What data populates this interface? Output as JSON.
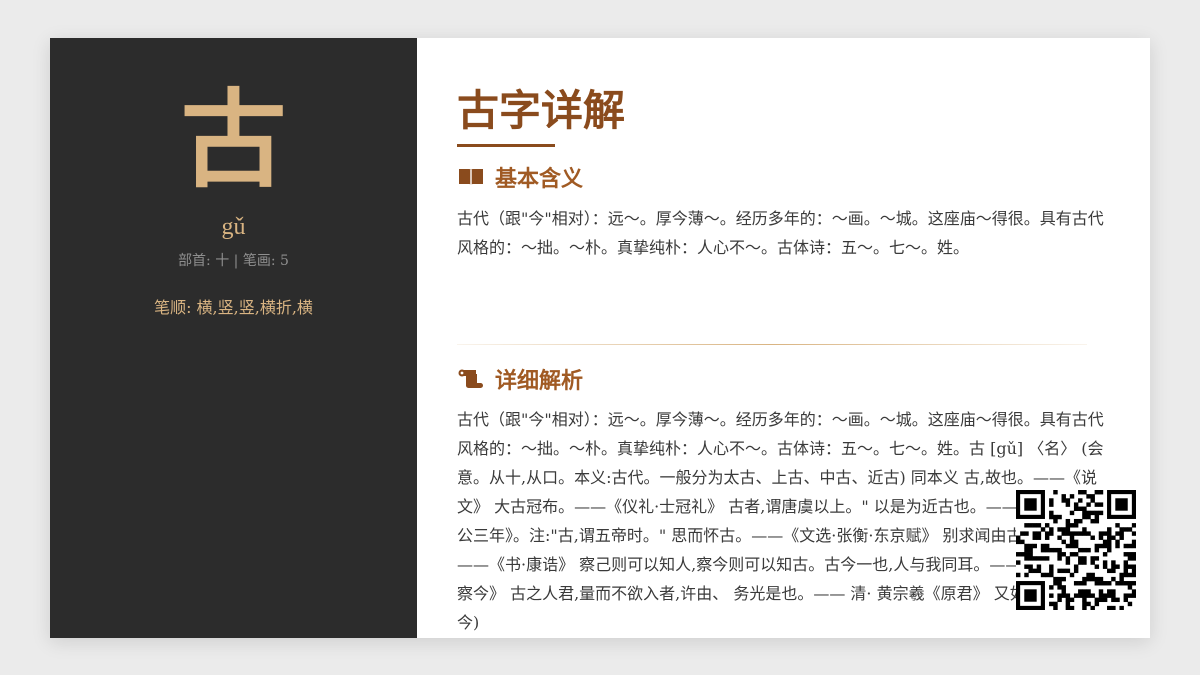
{
  "character": {
    "glyph": "古",
    "pinyin": "gǔ",
    "radical_strokes": "部首: 十 | 笔画: 5",
    "stroke_order": "笔顺: 横,竖,竖,横折,横"
  },
  "main": {
    "title": "古字详解",
    "basic": {
      "heading": "基本含义",
      "icon": "book-icon",
      "text": "古代（跟\"今\"相对）：远～。厚今薄～。经历多年的：～画。～城。这座庙～得很。具有古代风格的：～拙。～朴。真挚纯朴：人心不～。古体诗：五～。七～。姓。"
    },
    "detail": {
      "heading": "详细解析",
      "icon": "scroll-icon",
      "text": "古代（跟\"今\"相对）：远～。厚今薄～。经历多年的：～画。～城。这座庙～得很。具有古代风格的：～拙。～朴。真挚纯朴：人心不～。古体诗：五～。七～。姓。古 [gǔ] 〈名〉 (会意。从十,从口。本义:古代。一般分为太古、上古、中古、近古) 同本义 古,故也。——《说文》 大古冠布。——《仪礼·士冠礼》 古者,谓唐虞以上。\" 以是为近古也。——《谷梁传·桓公三年》。注:\"古,谓五帝时。\" 思而怀古。——《文选·张衡·东京赋》 别求闻由古先哲王。——《书·康诰》 察己则可以知人,察今则可以知古。古今一也,人与我同耳。——《吕氏春秋·察今》 古之人君,量而不欲入者,许由、 务光是也。—— 清· 黄宗羲《原君》 又如:迄古(迄今)"
    }
  },
  "colors": {
    "accent": "#8a4b1d",
    "gold": "#d9b482",
    "sidebar_bg": "#2c2c2c"
  },
  "qr_icon": "qr-code-icon"
}
